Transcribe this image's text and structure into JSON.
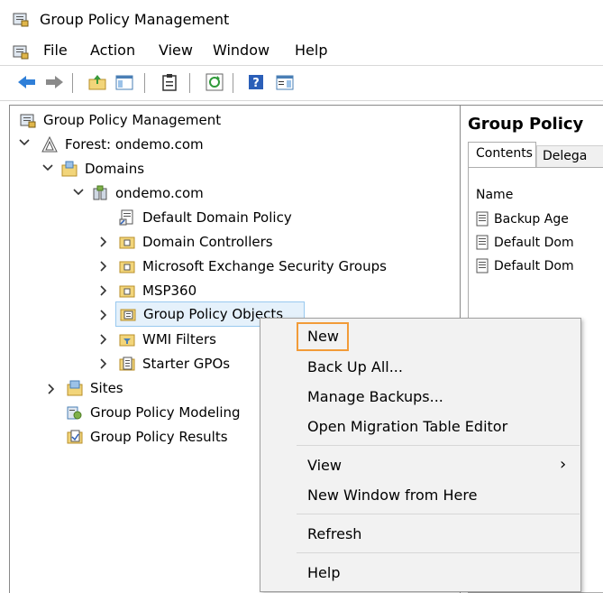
{
  "window": {
    "title": "Group Policy Management"
  },
  "menubar": {
    "items": [
      "File",
      "Action",
      "View",
      "Window",
      "Help"
    ]
  },
  "tree": {
    "root": "Group Policy Management",
    "forest": "Forest: ondemo.com",
    "domains": "Domains",
    "domain": "ondemo.com",
    "items": [
      "Default Domain Policy",
      "Domain Controllers",
      "Microsoft Exchange Security Groups",
      "MSP360",
      "Group Policy Objects",
      "WMI Filters",
      "Starter GPOs"
    ],
    "sites": "Sites",
    "modeling": "Group Policy Modeling",
    "results": "Group Policy Results"
  },
  "right_pane": {
    "title": "Group Policy",
    "tabs": [
      "Contents",
      "Delega"
    ],
    "column": "Name",
    "rows": [
      "Backup Age",
      "Default Dom",
      "Default Dom"
    ]
  },
  "context_menu": {
    "items": [
      "New",
      "Back Up All...",
      "Manage Backups...",
      "Open Migration Table Editor",
      "View",
      "New Window from Here",
      "Refresh",
      "Help"
    ],
    "submenu_arrow": "›"
  },
  "colors": {
    "highlight": "#e5f1fb",
    "selection_border": "#f29b38"
  }
}
